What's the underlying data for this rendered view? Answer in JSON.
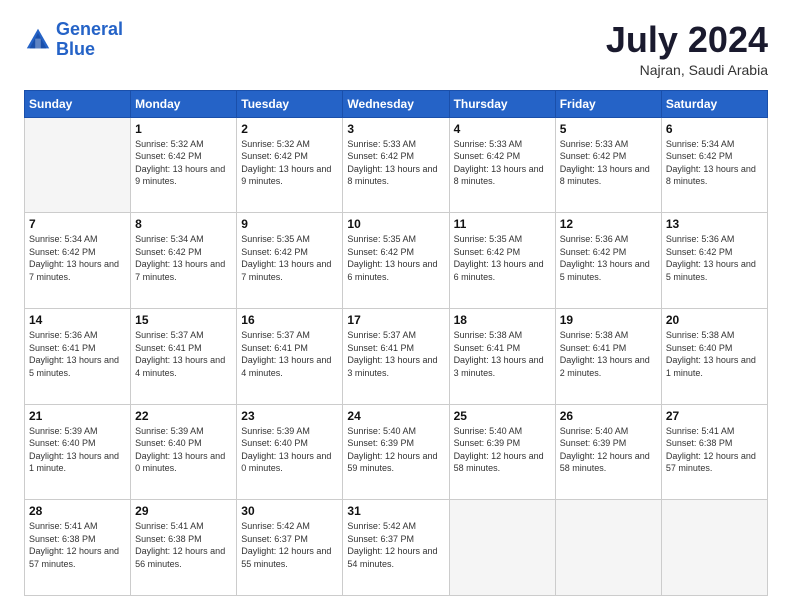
{
  "logo": {
    "line1": "General",
    "line2": "Blue"
  },
  "title": "July 2024",
  "location": "Najran, Saudi Arabia",
  "days_of_week": [
    "Sunday",
    "Monday",
    "Tuesday",
    "Wednesday",
    "Thursday",
    "Friday",
    "Saturday"
  ],
  "weeks": [
    [
      {
        "day": "",
        "info": ""
      },
      {
        "day": "1",
        "info": "Sunrise: 5:32 AM\nSunset: 6:42 PM\nDaylight: 13 hours and 9 minutes."
      },
      {
        "day": "2",
        "info": "Sunrise: 5:32 AM\nSunset: 6:42 PM\nDaylight: 13 hours and 9 minutes."
      },
      {
        "day": "3",
        "info": "Sunrise: 5:33 AM\nSunset: 6:42 PM\nDaylight: 13 hours and 8 minutes."
      },
      {
        "day": "4",
        "info": "Sunrise: 5:33 AM\nSunset: 6:42 PM\nDaylight: 13 hours and 8 minutes."
      },
      {
        "day": "5",
        "info": "Sunrise: 5:33 AM\nSunset: 6:42 PM\nDaylight: 13 hours and 8 minutes."
      },
      {
        "day": "6",
        "info": "Sunrise: 5:34 AM\nSunset: 6:42 PM\nDaylight: 13 hours and 8 minutes."
      }
    ],
    [
      {
        "day": "7",
        "info": "Sunrise: 5:34 AM\nSunset: 6:42 PM\nDaylight: 13 hours and 7 minutes."
      },
      {
        "day": "8",
        "info": "Sunrise: 5:34 AM\nSunset: 6:42 PM\nDaylight: 13 hours and 7 minutes."
      },
      {
        "day": "9",
        "info": "Sunrise: 5:35 AM\nSunset: 6:42 PM\nDaylight: 13 hours and 7 minutes."
      },
      {
        "day": "10",
        "info": "Sunrise: 5:35 AM\nSunset: 6:42 PM\nDaylight: 13 hours and 6 minutes."
      },
      {
        "day": "11",
        "info": "Sunrise: 5:35 AM\nSunset: 6:42 PM\nDaylight: 13 hours and 6 minutes."
      },
      {
        "day": "12",
        "info": "Sunrise: 5:36 AM\nSunset: 6:42 PM\nDaylight: 13 hours and 5 minutes."
      },
      {
        "day": "13",
        "info": "Sunrise: 5:36 AM\nSunset: 6:42 PM\nDaylight: 13 hours and 5 minutes."
      }
    ],
    [
      {
        "day": "14",
        "info": "Sunrise: 5:36 AM\nSunset: 6:41 PM\nDaylight: 13 hours and 5 minutes."
      },
      {
        "day": "15",
        "info": "Sunrise: 5:37 AM\nSunset: 6:41 PM\nDaylight: 13 hours and 4 minutes."
      },
      {
        "day": "16",
        "info": "Sunrise: 5:37 AM\nSunset: 6:41 PM\nDaylight: 13 hours and 4 minutes."
      },
      {
        "day": "17",
        "info": "Sunrise: 5:37 AM\nSunset: 6:41 PM\nDaylight: 13 hours and 3 minutes."
      },
      {
        "day": "18",
        "info": "Sunrise: 5:38 AM\nSunset: 6:41 PM\nDaylight: 13 hours and 3 minutes."
      },
      {
        "day": "19",
        "info": "Sunrise: 5:38 AM\nSunset: 6:41 PM\nDaylight: 13 hours and 2 minutes."
      },
      {
        "day": "20",
        "info": "Sunrise: 5:38 AM\nSunset: 6:40 PM\nDaylight: 13 hours and 1 minute."
      }
    ],
    [
      {
        "day": "21",
        "info": "Sunrise: 5:39 AM\nSunset: 6:40 PM\nDaylight: 13 hours and 1 minute."
      },
      {
        "day": "22",
        "info": "Sunrise: 5:39 AM\nSunset: 6:40 PM\nDaylight: 13 hours and 0 minutes."
      },
      {
        "day": "23",
        "info": "Sunrise: 5:39 AM\nSunset: 6:40 PM\nDaylight: 13 hours and 0 minutes."
      },
      {
        "day": "24",
        "info": "Sunrise: 5:40 AM\nSunset: 6:39 PM\nDaylight: 12 hours and 59 minutes."
      },
      {
        "day": "25",
        "info": "Sunrise: 5:40 AM\nSunset: 6:39 PM\nDaylight: 12 hours and 58 minutes."
      },
      {
        "day": "26",
        "info": "Sunrise: 5:40 AM\nSunset: 6:39 PM\nDaylight: 12 hours and 58 minutes."
      },
      {
        "day": "27",
        "info": "Sunrise: 5:41 AM\nSunset: 6:38 PM\nDaylight: 12 hours and 57 minutes."
      }
    ],
    [
      {
        "day": "28",
        "info": "Sunrise: 5:41 AM\nSunset: 6:38 PM\nDaylight: 12 hours and 57 minutes."
      },
      {
        "day": "29",
        "info": "Sunrise: 5:41 AM\nSunset: 6:38 PM\nDaylight: 12 hours and 56 minutes."
      },
      {
        "day": "30",
        "info": "Sunrise: 5:42 AM\nSunset: 6:37 PM\nDaylight: 12 hours and 55 minutes."
      },
      {
        "day": "31",
        "info": "Sunrise: 5:42 AM\nSunset: 6:37 PM\nDaylight: 12 hours and 54 minutes."
      },
      {
        "day": "",
        "info": ""
      },
      {
        "day": "",
        "info": ""
      },
      {
        "day": "",
        "info": ""
      }
    ]
  ]
}
